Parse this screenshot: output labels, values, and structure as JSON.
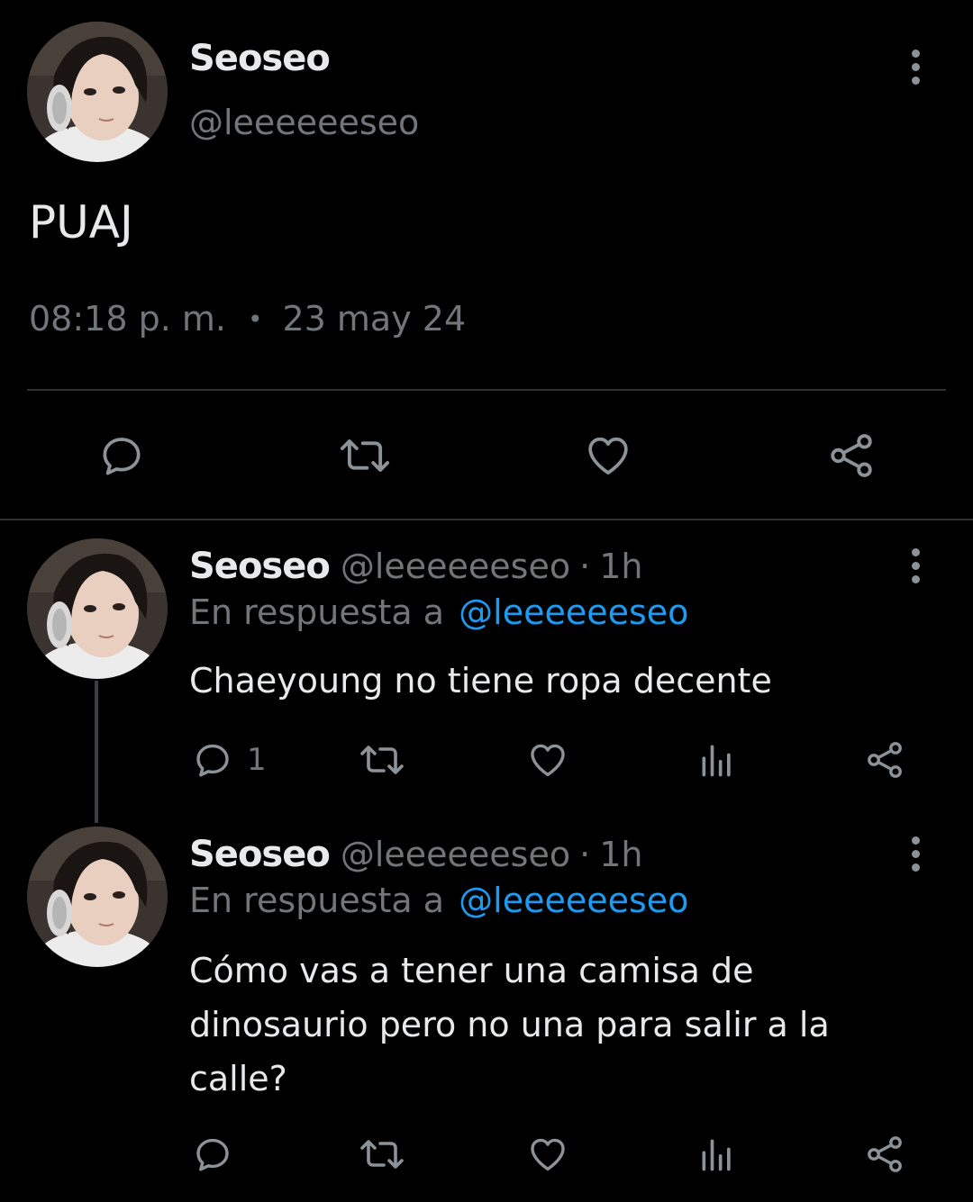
{
  "main_tweet": {
    "display_name": "Seoseo",
    "handle": "@leeeeeeseo",
    "text": "PUAJ",
    "time": "08:18 p. m.",
    "separator": "•",
    "date": "23 may 24"
  },
  "replies": [
    {
      "display_name": "Seoseo",
      "handle": "@leeeeeeseo",
      "separator": "·",
      "time": "1h",
      "reply_prefix": "En respuesta a",
      "reply_to": "@leeeeeeseo",
      "text": "Chaeyoung no tiene ropa decente",
      "reply_count": "1"
    },
    {
      "display_name": "Seoseo",
      "handle": "@leeeeeeseo",
      "separator": "·",
      "time": "1h",
      "reply_prefix": "En respuesta a",
      "reply_to": "@leeeeeeseo",
      "text": "Cómo vas a tener una camisa de dinosaurio pero no una para salir a la calle?",
      "reply_count": ""
    }
  ],
  "colors": {
    "background": "#000000",
    "text_primary": "#e7e9ea",
    "text_secondary": "#71767b",
    "link": "#1d9bf0",
    "divider": "#2f3336"
  },
  "icons": {
    "reply": "reply-icon",
    "retweet": "retweet-icon",
    "like": "heart-icon",
    "share": "share-icon",
    "views": "views-icon",
    "more": "more-vertical-icon"
  }
}
